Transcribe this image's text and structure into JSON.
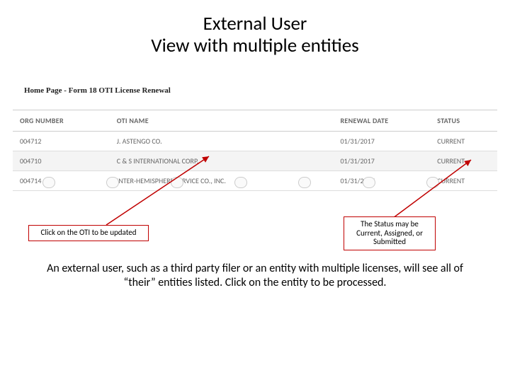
{
  "title": {
    "line1": "External User",
    "line2": "View with multiple entities"
  },
  "page_header": "Home Page - Form 18 OTI License Renewal",
  "table": {
    "headers": {
      "org": "ORG NUMBER",
      "name": "OTI NAME",
      "date": "RENEWAL DATE",
      "status": "STATUS"
    },
    "rows": [
      {
        "org": "004712",
        "name": "J. ASTENGO CO.",
        "date": "01/31/2017",
        "status": "CURRENT"
      },
      {
        "org": "004710",
        "name": "C & S INTERNATIONAL CORP.",
        "date": "01/31/2017",
        "status": "CURRENT"
      },
      {
        "org": "004714",
        "name": "INTER-HEMISPHERE SERVICE CO., INC.",
        "date": "01/31/2017",
        "status": "CURRENT"
      }
    ]
  },
  "callouts": {
    "left": "Click on the OTI to be updated",
    "right": "The Status may be Current, Assigned, or Submitted"
  },
  "body": "An external user, such as a third party filer or an entity with multiple licenses, will see all of “their” entities listed.   Click on the entity to be processed."
}
